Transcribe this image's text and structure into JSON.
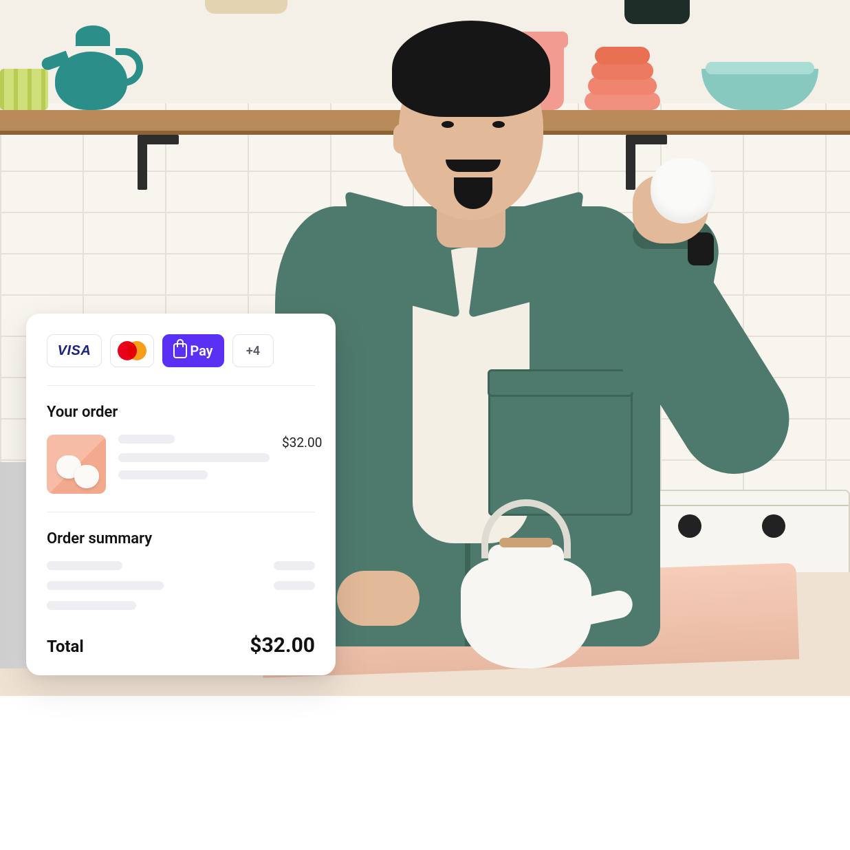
{
  "checkout": {
    "payment_methods": {
      "visa_label": "VISA",
      "mastercard_label": "mastercard",
      "shop_pay_label": "Pay",
      "more_label": "+4"
    },
    "order": {
      "heading": "Your order",
      "items": [
        {
          "thumb_alt": "two white cups on pink",
          "price": "$32.00"
        }
      ]
    },
    "summary": {
      "heading": "Order summary",
      "total_label": "Total",
      "total_value": "$32.00"
    }
  }
}
